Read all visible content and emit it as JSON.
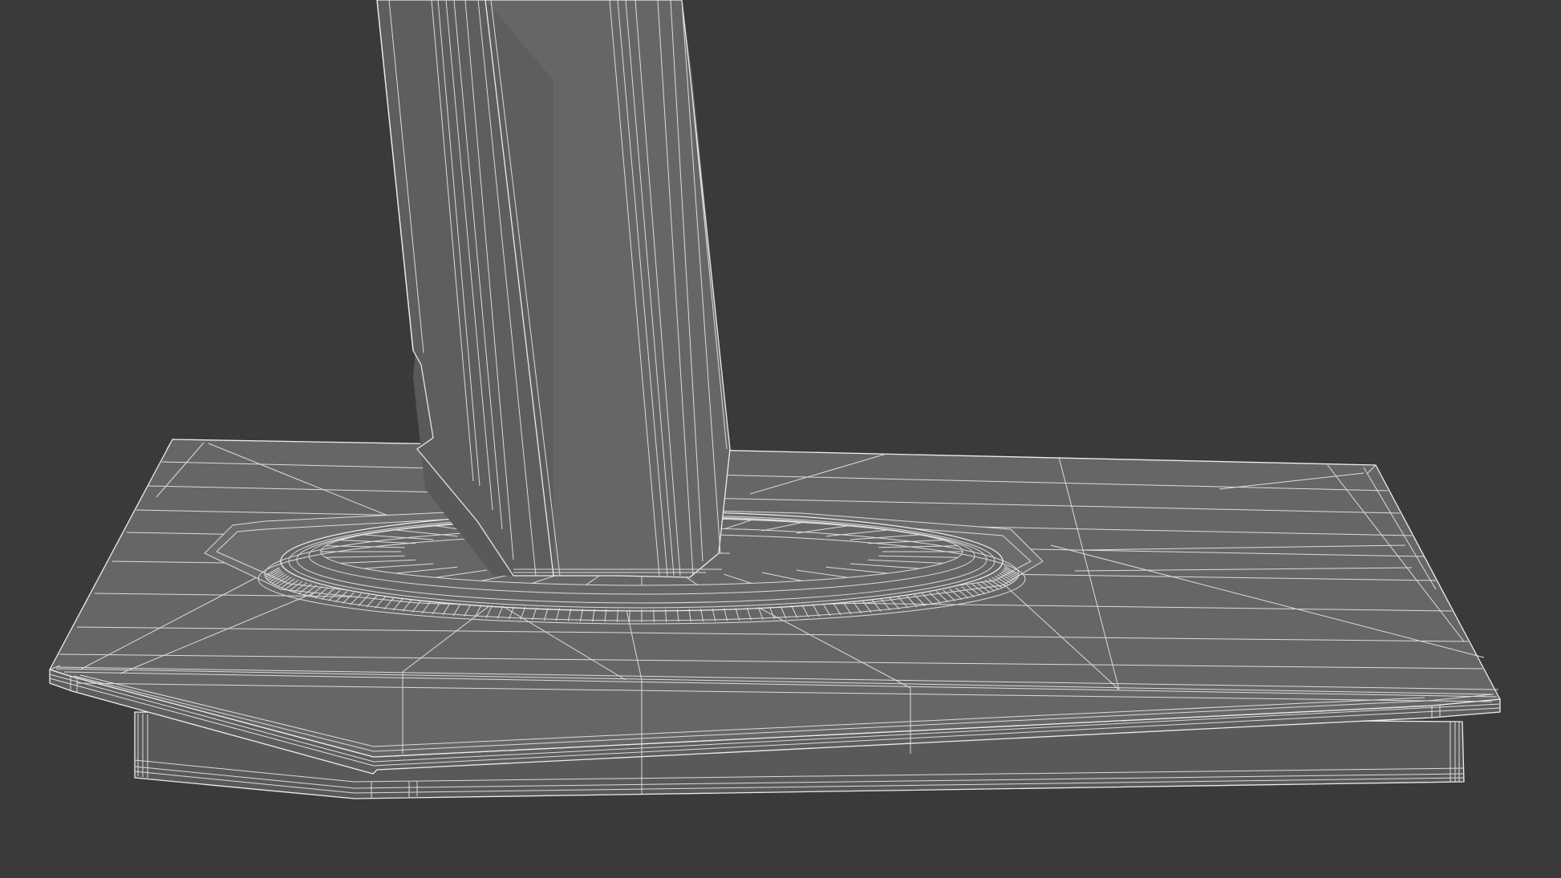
{
  "colors": {
    "background": "#3a3a3a",
    "surface": "#666666",
    "wire": "#ececec"
  }
}
